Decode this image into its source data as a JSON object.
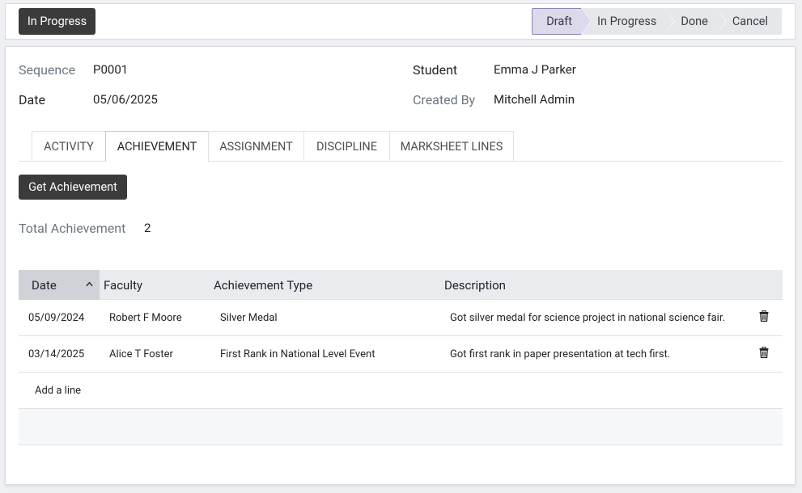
{
  "status_button": {
    "label": "In Progress"
  },
  "stages": [
    {
      "label": "Draft",
      "active": true
    },
    {
      "label": "In Progress",
      "active": false
    },
    {
      "label": "Done",
      "active": false
    },
    {
      "label": "Cancel",
      "active": false
    }
  ],
  "form": {
    "sequence": {
      "label": "Sequence",
      "value": "P0001"
    },
    "date": {
      "label": "Date",
      "value": "05/06/2025"
    },
    "student": {
      "label": "Student",
      "value": "Emma J Parker"
    },
    "created_by": {
      "label": "Created By",
      "value": "Mitchell Admin"
    }
  },
  "tabs": [
    {
      "label": "ACTIVITY"
    },
    {
      "label": "ACHIEVEMENT",
      "active": true
    },
    {
      "label": "ASSIGNMENT"
    },
    {
      "label": "DISCIPLINE"
    },
    {
      "label": "MARKSHEET LINES"
    }
  ],
  "achievement": {
    "get_button": "Get Achievement",
    "total_label": "Total Achievement",
    "total_value": "2",
    "columns": {
      "date": "Date",
      "faculty": "Faculty",
      "type": "Achievement Type",
      "description": "Description"
    },
    "rows": [
      {
        "date": "05/09/2024",
        "faculty": "Robert F Moore",
        "type": "Silver Medal",
        "description": "Got silver medal for science project in national science fair."
      },
      {
        "date": "03/14/2025",
        "faculty": "Alice T Foster",
        "type": "First Rank in National Level Event",
        "description": "Got first rank in paper presentation at tech first."
      }
    ],
    "add_line": "Add a line"
  },
  "icons": {
    "sort": "chevron-up-icon",
    "delete": "trash-icon"
  },
  "colors": {
    "dark_button": "#3b3b3b",
    "active_stage": "#dcd9ea",
    "active_stage_border": "#8b84b3"
  }
}
